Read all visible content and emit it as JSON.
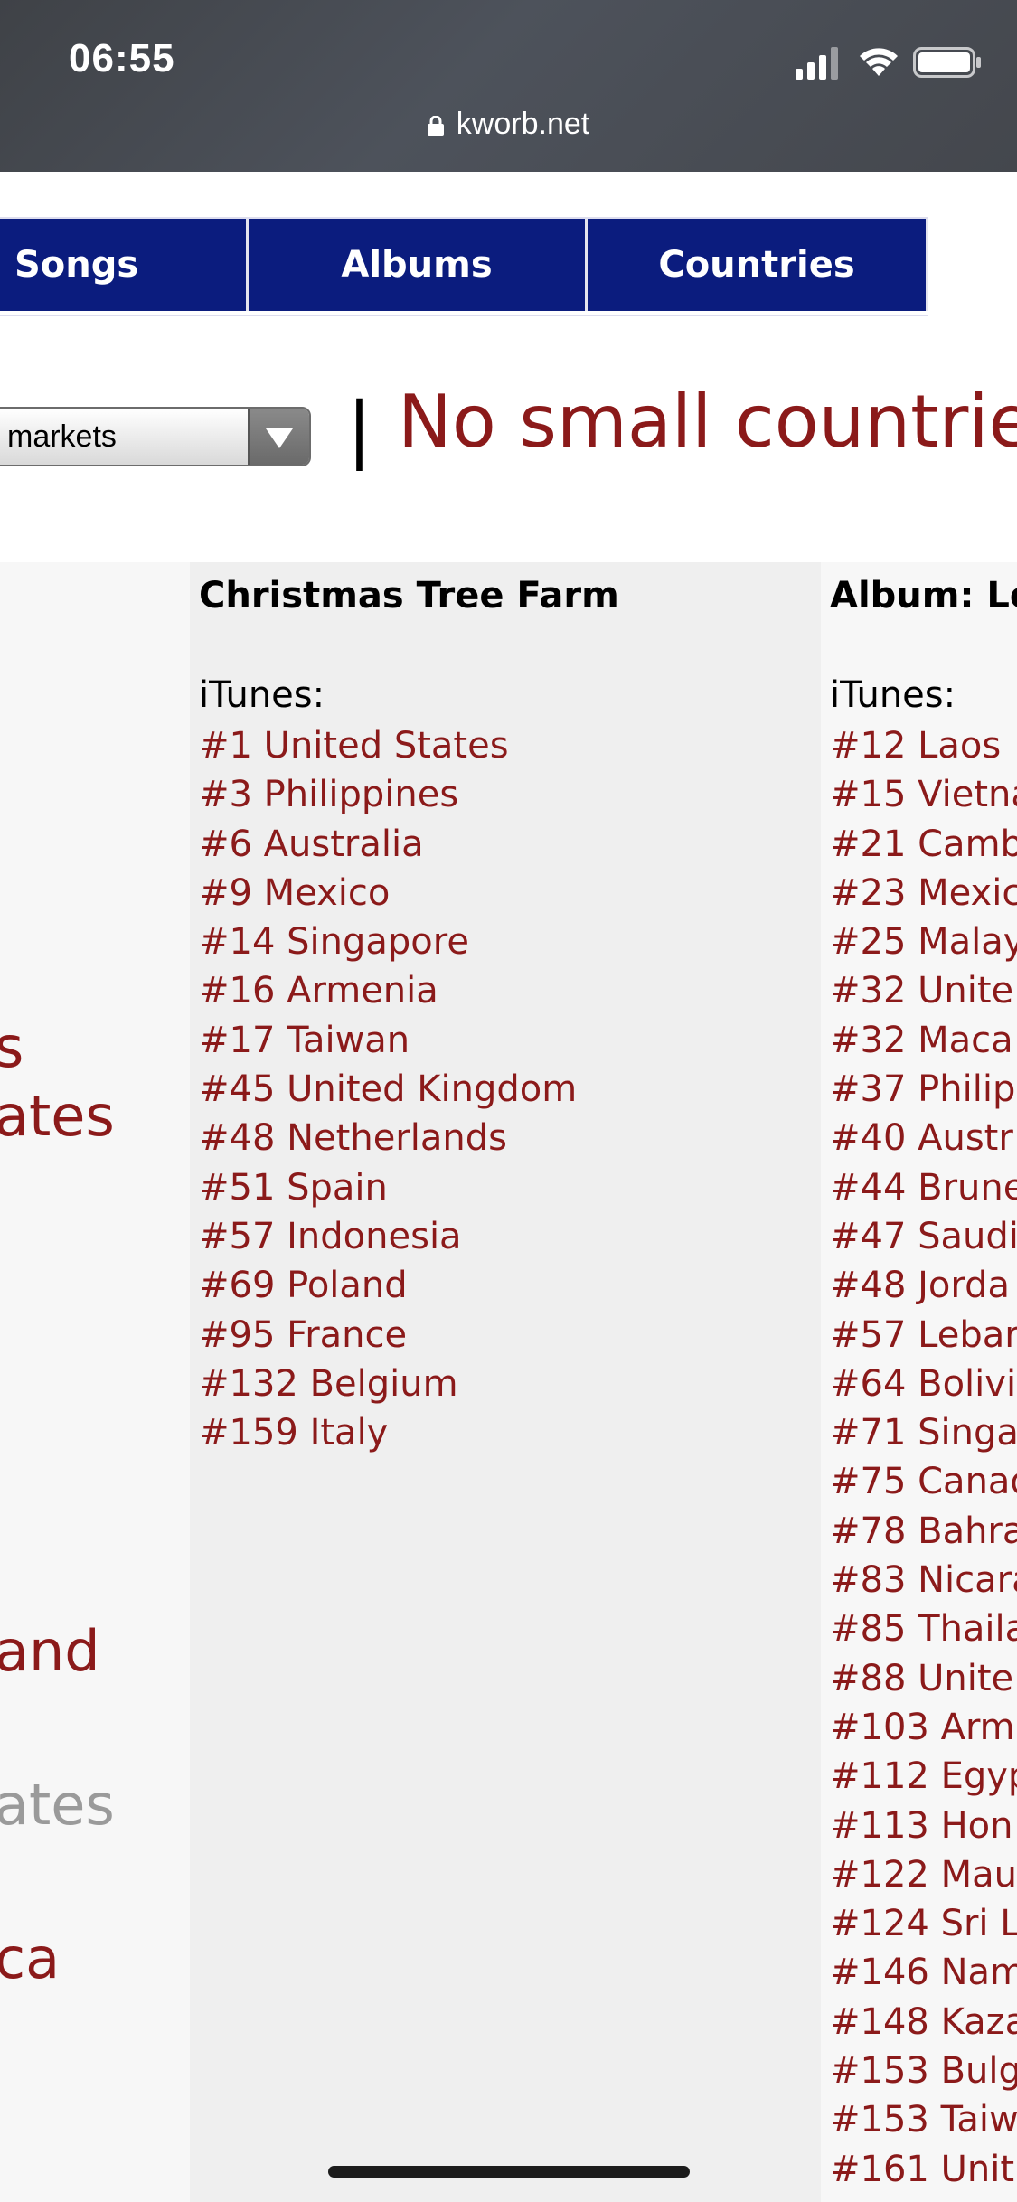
{
  "status_bar": {
    "time": "06:55",
    "url": "kworb.net"
  },
  "nav": {
    "tabs": [
      "Songs",
      "Albums",
      "Countries"
    ]
  },
  "controls": {
    "market_select": "markets",
    "separator": "|",
    "filter_text": "No small countrie"
  },
  "left_fragments": [
    "s",
    "ates",
    "and",
    "ates",
    "ca"
  ],
  "song_column": {
    "title": "Christmas Tree Farm",
    "store": "iTunes:",
    "entries": [
      "#1 United States",
      "#3 Philippines",
      "#6 Australia",
      "#9 Mexico",
      "#14 Singapore",
      "#16 Armenia",
      "#17 Taiwan",
      "#45 United Kingdom",
      "#48 Netherlands",
      "#51 Spain",
      "#57 Indonesia",
      "#69 Poland",
      "#95 France",
      "#132 Belgium",
      "#159 Italy"
    ]
  },
  "album_column": {
    "title": "Album: Lo",
    "store": "iTunes:",
    "entries": [
      "#12 Laos",
      "#15 Vietna",
      "#21 Camb",
      "#23 Mexic",
      "#25 Malay",
      "#32 Unite",
      "#32 Maca",
      "#37 Philip",
      "#40 Austr",
      "#44 Brune",
      "#47 Saudi",
      "#48 Jorda",
      "#57 Lebar",
      "#64 Bolivi",
      "#71 Singa",
      "#75 Canad",
      "#78 Bahra",
      "#83 Nicara",
      "#85 Thaila",
      "#88 Unite",
      "#103 Arm",
      "#112 Egyp",
      "#113 Hon",
      "#122 Mau",
      "#124 Sri L",
      "#146 Nam",
      "#148 Kaza",
      "#153 Bulg",
      "#153 Taiw",
      "#161 Unit"
    ]
  },
  "colors": {
    "nav_bg": "#0b1c7e",
    "link": "#8b1a1a"
  }
}
